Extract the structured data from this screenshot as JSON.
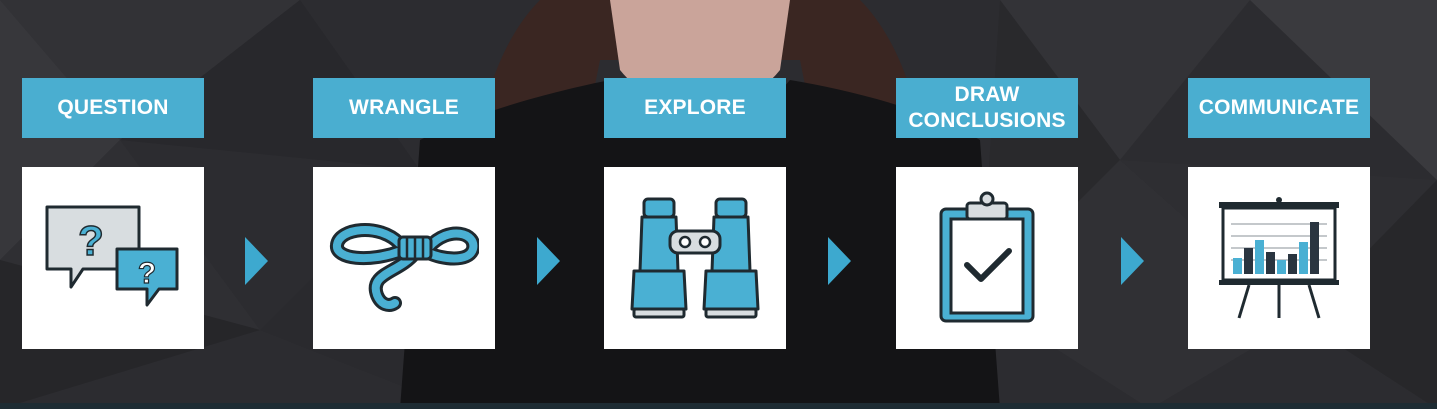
{
  "steps": [
    {
      "label": "QUESTION",
      "icon": "speech-bubbles-question-icon"
    },
    {
      "label": "WRANGLE",
      "icon": "rope-icon"
    },
    {
      "label": "EXPLORE",
      "icon": "binoculars-icon"
    },
    {
      "label": "DRAW CONCLUSIONS",
      "icon": "clipboard-check-icon"
    },
    {
      "label": "COMMUNICATE",
      "icon": "presentation-chart-icon"
    }
  ],
  "colors": {
    "accent": "#4aaed0",
    "icon_blue": "#4ab0d3",
    "outline": "#1f2a30",
    "background": "#2b2b2f",
    "card": "#ffffff"
  }
}
